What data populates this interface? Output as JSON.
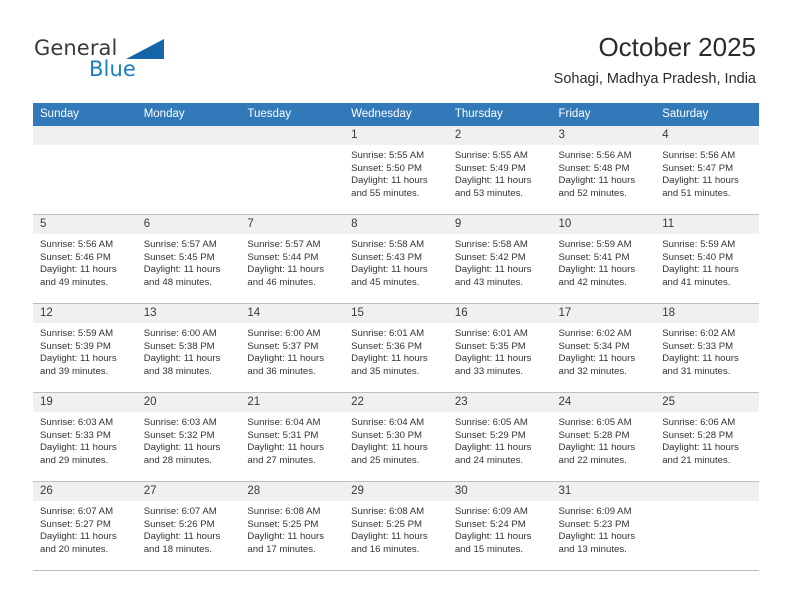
{
  "brand": {
    "name_part1": "General",
    "name_part2": "Blue",
    "logo_icon": "triangle-flag-icon",
    "accent_color": "#1565a8",
    "blue_text_color": "#1b7ec4"
  },
  "header": {
    "title": "October 2025",
    "subtitle": "Sohagi, Madhya Pradesh, India"
  },
  "theme": {
    "header_row_bg": "#3179b9",
    "daynum_band_bg": "#f0f0f0",
    "grid_line": "#bfbfbf",
    "text": "#333333"
  },
  "weekdays": [
    "Sunday",
    "Monday",
    "Tuesday",
    "Wednesday",
    "Thursday",
    "Friday",
    "Saturday"
  ],
  "weeks": [
    [
      {
        "day": "",
        "lines": []
      },
      {
        "day": "",
        "lines": []
      },
      {
        "day": "",
        "lines": []
      },
      {
        "day": "1",
        "lines": [
          "Sunrise: 5:55 AM",
          "Sunset: 5:50 PM",
          "Daylight: 11 hours",
          "and 55 minutes."
        ]
      },
      {
        "day": "2",
        "lines": [
          "Sunrise: 5:55 AM",
          "Sunset: 5:49 PM",
          "Daylight: 11 hours",
          "and 53 minutes."
        ]
      },
      {
        "day": "3",
        "lines": [
          "Sunrise: 5:56 AM",
          "Sunset: 5:48 PM",
          "Daylight: 11 hours",
          "and 52 minutes."
        ]
      },
      {
        "day": "4",
        "lines": [
          "Sunrise: 5:56 AM",
          "Sunset: 5:47 PM",
          "Daylight: 11 hours",
          "and 51 minutes."
        ]
      }
    ],
    [
      {
        "day": "5",
        "lines": [
          "Sunrise: 5:56 AM",
          "Sunset: 5:46 PM",
          "Daylight: 11 hours",
          "and 49 minutes."
        ]
      },
      {
        "day": "6",
        "lines": [
          "Sunrise: 5:57 AM",
          "Sunset: 5:45 PM",
          "Daylight: 11 hours",
          "and 48 minutes."
        ]
      },
      {
        "day": "7",
        "lines": [
          "Sunrise: 5:57 AM",
          "Sunset: 5:44 PM",
          "Daylight: 11 hours",
          "and 46 minutes."
        ]
      },
      {
        "day": "8",
        "lines": [
          "Sunrise: 5:58 AM",
          "Sunset: 5:43 PM",
          "Daylight: 11 hours",
          "and 45 minutes."
        ]
      },
      {
        "day": "9",
        "lines": [
          "Sunrise: 5:58 AM",
          "Sunset: 5:42 PM",
          "Daylight: 11 hours",
          "and 43 minutes."
        ]
      },
      {
        "day": "10",
        "lines": [
          "Sunrise: 5:59 AM",
          "Sunset: 5:41 PM",
          "Daylight: 11 hours",
          "and 42 minutes."
        ]
      },
      {
        "day": "11",
        "lines": [
          "Sunrise: 5:59 AM",
          "Sunset: 5:40 PM",
          "Daylight: 11 hours",
          "and 41 minutes."
        ]
      }
    ],
    [
      {
        "day": "12",
        "lines": [
          "Sunrise: 5:59 AM",
          "Sunset: 5:39 PM",
          "Daylight: 11 hours",
          "and 39 minutes."
        ]
      },
      {
        "day": "13",
        "lines": [
          "Sunrise: 6:00 AM",
          "Sunset: 5:38 PM",
          "Daylight: 11 hours",
          "and 38 minutes."
        ]
      },
      {
        "day": "14",
        "lines": [
          "Sunrise: 6:00 AM",
          "Sunset: 5:37 PM",
          "Daylight: 11 hours",
          "and 36 minutes."
        ]
      },
      {
        "day": "15",
        "lines": [
          "Sunrise: 6:01 AM",
          "Sunset: 5:36 PM",
          "Daylight: 11 hours",
          "and 35 minutes."
        ]
      },
      {
        "day": "16",
        "lines": [
          "Sunrise: 6:01 AM",
          "Sunset: 5:35 PM",
          "Daylight: 11 hours",
          "and 33 minutes."
        ]
      },
      {
        "day": "17",
        "lines": [
          "Sunrise: 6:02 AM",
          "Sunset: 5:34 PM",
          "Daylight: 11 hours",
          "and 32 minutes."
        ]
      },
      {
        "day": "18",
        "lines": [
          "Sunrise: 6:02 AM",
          "Sunset: 5:33 PM",
          "Daylight: 11 hours",
          "and 31 minutes."
        ]
      }
    ],
    [
      {
        "day": "19",
        "lines": [
          "Sunrise: 6:03 AM",
          "Sunset: 5:33 PM",
          "Daylight: 11 hours",
          "and 29 minutes."
        ]
      },
      {
        "day": "20",
        "lines": [
          "Sunrise: 6:03 AM",
          "Sunset: 5:32 PM",
          "Daylight: 11 hours",
          "and 28 minutes."
        ]
      },
      {
        "day": "21",
        "lines": [
          "Sunrise: 6:04 AM",
          "Sunset: 5:31 PM",
          "Daylight: 11 hours",
          "and 27 minutes."
        ]
      },
      {
        "day": "22",
        "lines": [
          "Sunrise: 6:04 AM",
          "Sunset: 5:30 PM",
          "Daylight: 11 hours",
          "and 25 minutes."
        ]
      },
      {
        "day": "23",
        "lines": [
          "Sunrise: 6:05 AM",
          "Sunset: 5:29 PM",
          "Daylight: 11 hours",
          "and 24 minutes."
        ]
      },
      {
        "day": "24",
        "lines": [
          "Sunrise: 6:05 AM",
          "Sunset: 5:28 PM",
          "Daylight: 11 hours",
          "and 22 minutes."
        ]
      },
      {
        "day": "25",
        "lines": [
          "Sunrise: 6:06 AM",
          "Sunset: 5:28 PM",
          "Daylight: 11 hours",
          "and 21 minutes."
        ]
      }
    ],
    [
      {
        "day": "26",
        "lines": [
          "Sunrise: 6:07 AM",
          "Sunset: 5:27 PM",
          "Daylight: 11 hours",
          "and 20 minutes."
        ]
      },
      {
        "day": "27",
        "lines": [
          "Sunrise: 6:07 AM",
          "Sunset: 5:26 PM",
          "Daylight: 11 hours",
          "and 18 minutes."
        ]
      },
      {
        "day": "28",
        "lines": [
          "Sunrise: 6:08 AM",
          "Sunset: 5:25 PM",
          "Daylight: 11 hours",
          "and 17 minutes."
        ]
      },
      {
        "day": "29",
        "lines": [
          "Sunrise: 6:08 AM",
          "Sunset: 5:25 PM",
          "Daylight: 11 hours",
          "and 16 minutes."
        ]
      },
      {
        "day": "30",
        "lines": [
          "Sunrise: 6:09 AM",
          "Sunset: 5:24 PM",
          "Daylight: 11 hours",
          "and 15 minutes."
        ]
      },
      {
        "day": "31",
        "lines": [
          "Sunrise: 6:09 AM",
          "Sunset: 5:23 PM",
          "Daylight: 11 hours",
          "and 13 minutes."
        ]
      },
      {
        "day": "",
        "lines": []
      }
    ]
  ]
}
